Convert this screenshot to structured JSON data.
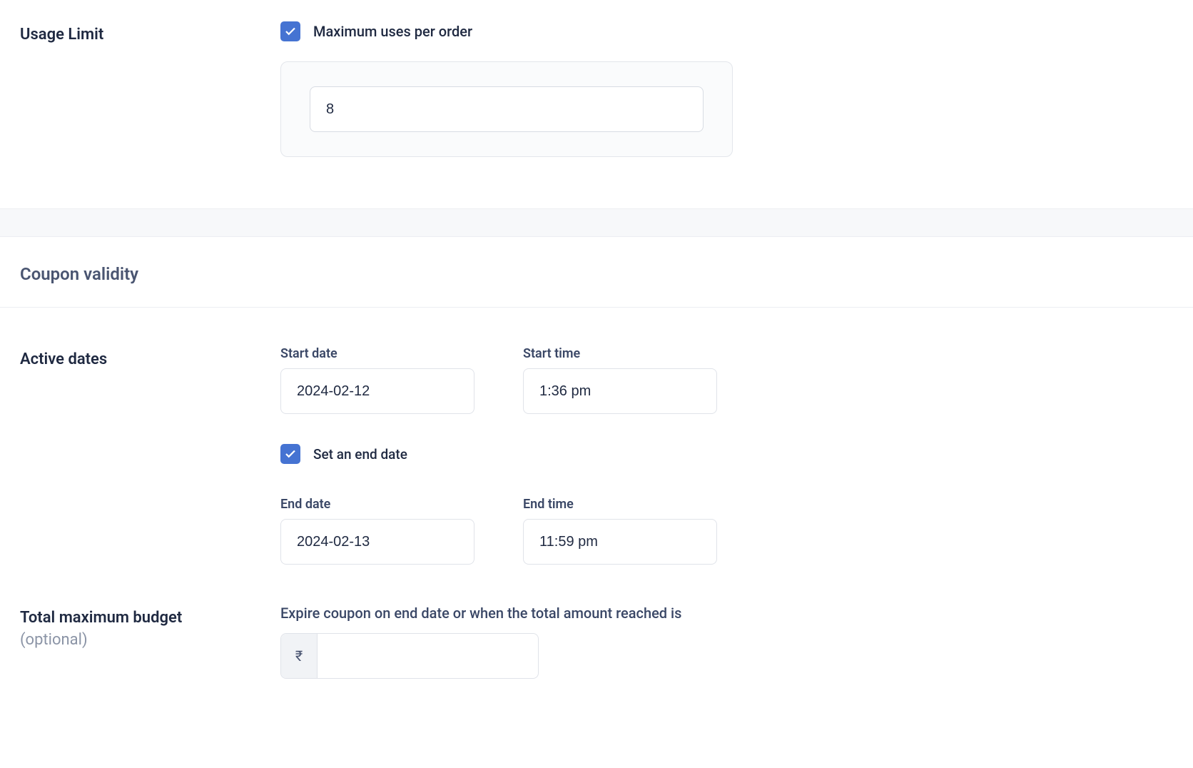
{
  "usage_limit": {
    "section_label": "Usage Limit",
    "max_uses_label": "Maximum uses per order",
    "max_uses_checked": true,
    "max_uses_value": "8"
  },
  "coupon_validity": {
    "heading": "Coupon validity"
  },
  "active_dates": {
    "section_label": "Active dates",
    "start_date_label": "Start date",
    "start_date_value": "2024-02-12",
    "start_time_label": "Start time",
    "start_time_value": "1:36 pm",
    "set_end_date_label": "Set an end date",
    "set_end_date_checked": true,
    "end_date_label": "End date",
    "end_date_value": "2024-02-13",
    "end_time_label": "End time",
    "end_time_value": "11:59 pm"
  },
  "budget": {
    "section_label": "Total maximum budget",
    "section_sublabel": "(optional)",
    "description": "Expire coupon on end date or when the total amount reached is",
    "currency_symbol": "₹",
    "amount": ""
  }
}
